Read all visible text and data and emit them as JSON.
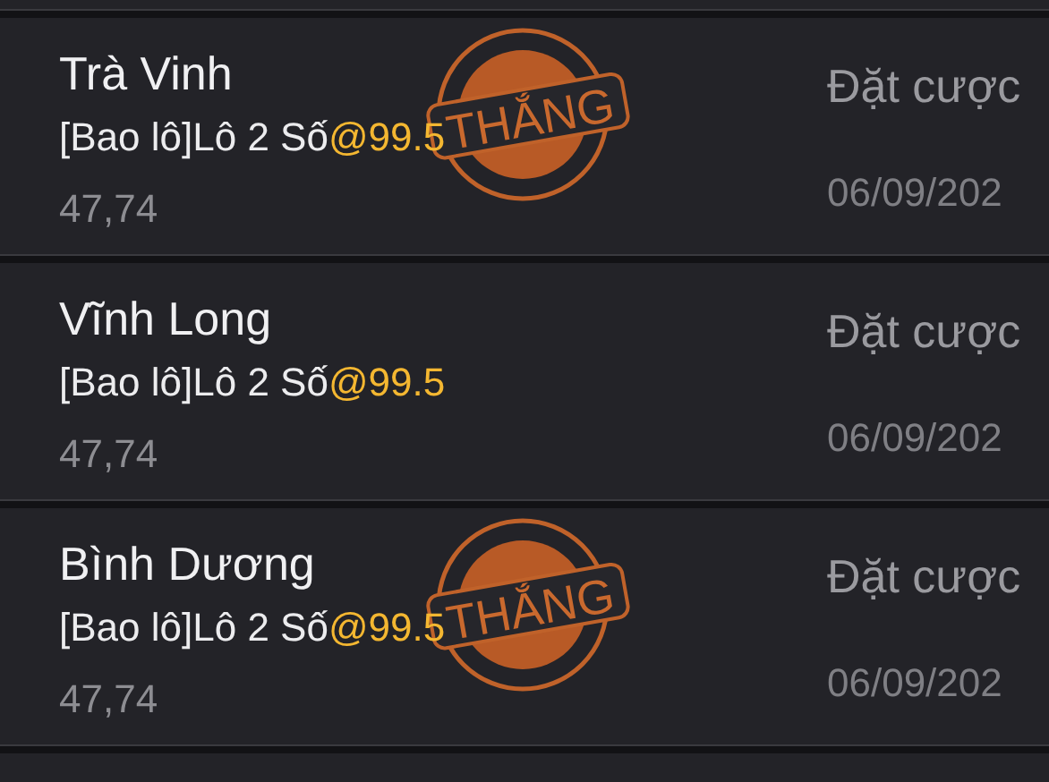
{
  "bets": [
    {
      "province": "Trà Vinh",
      "bet": "[Bao lô]Lô 2 Số",
      "odds": "@99.5",
      "amount": "47,74",
      "status": "Đặt cược",
      "date": "06/09/202",
      "stamp": "THẮNG"
    },
    {
      "province": "Vĩnh Long",
      "bet": "[Bao lô]Lô 2 Số",
      "odds": "@99.5",
      "amount": "47,74",
      "status": "Đặt cược",
      "date": "06/09/202"
    },
    {
      "province": "Bình Dương",
      "bet": "[Bao lô]Lô 2 Số",
      "odds": "@99.5",
      "amount": "47,74",
      "status": "Đặt cược",
      "date": "06/09/202",
      "stamp": "THẮNG"
    }
  ]
}
